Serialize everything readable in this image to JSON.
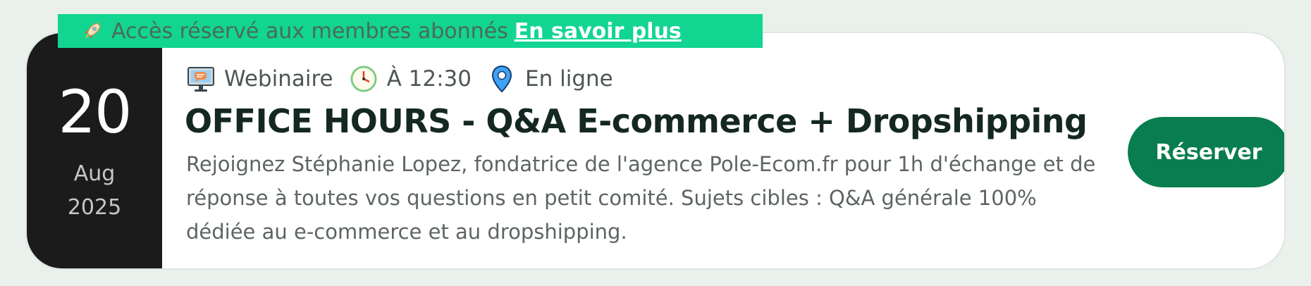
{
  "banner": {
    "text": "Accès réservé aux membres abonnés",
    "link_label": "En savoir plus",
    "icon": "rocket-icon"
  },
  "event": {
    "date": {
      "day": "20",
      "month": "Aug",
      "year": "2025"
    },
    "meta": {
      "type_label": "Webinaire",
      "type_icon": "monitor-chat-icon",
      "time_label": "À 12:30",
      "time_icon": "clock-icon",
      "location_label": "En ligne",
      "location_icon": "map-pin-icon"
    },
    "title": "OFFICE HOURS - Q&A E-commerce + Dropshipping",
    "description": "Rejoignez Stéphanie Lopez, fondatrice de l'agence Pole-Ecom.fr pour 1h d'échange et de réponse à toutes vos questions en petit comité. Sujets cibles : Q&A générale 100% dédiée au e-commerce et au dropshipping.",
    "reserve_label": "Réserver"
  },
  "colors": {
    "page_background": "#eaf0ec",
    "banner_green": "#12d591",
    "button_green": "#0a7d50",
    "date_block": "#1b1b1b",
    "title_text": "#142820"
  }
}
